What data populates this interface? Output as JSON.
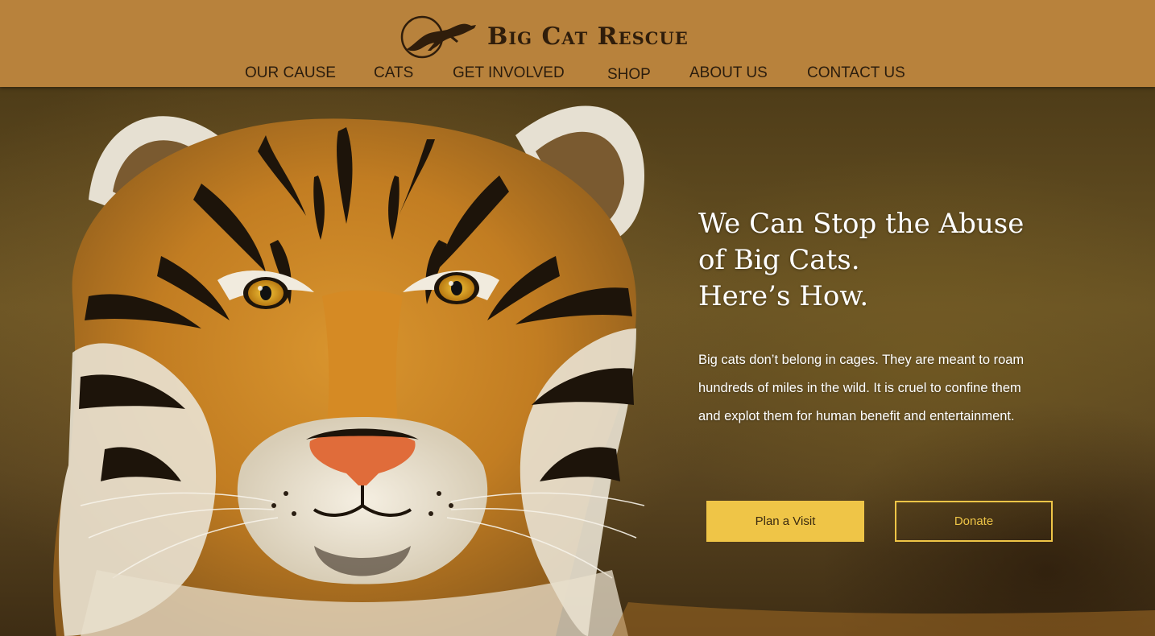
{
  "header": {
    "logo_text": "Big Cat Rescue",
    "logo_icon": "leaping-cat-icon",
    "background_color": "#b8823c"
  },
  "nav": {
    "items": [
      {
        "label": "OUR CAUSE"
      },
      {
        "label": "CATS"
      },
      {
        "label": "GET INVOLVED"
      },
      {
        "label": "SHOP"
      },
      {
        "label": "ABOUT US"
      },
      {
        "label": "CONTACT US"
      }
    ]
  },
  "hero": {
    "image": "tiger-face-photo",
    "title_lines": [
      "We Can Stop the Abuse",
      "of Big Cats.",
      "Here’s How."
    ],
    "body_lines": [
      "Big cats don’t belong in cages.  They are meant to roam",
      "hundreds of miles in the wild.  It is cruel to confine them",
      "and explot them for human benefit and entertainment."
    ],
    "buttons": {
      "plan_visit": "Plan a Visit",
      "donate": "Donate"
    },
    "accent_color": "#efc547"
  }
}
